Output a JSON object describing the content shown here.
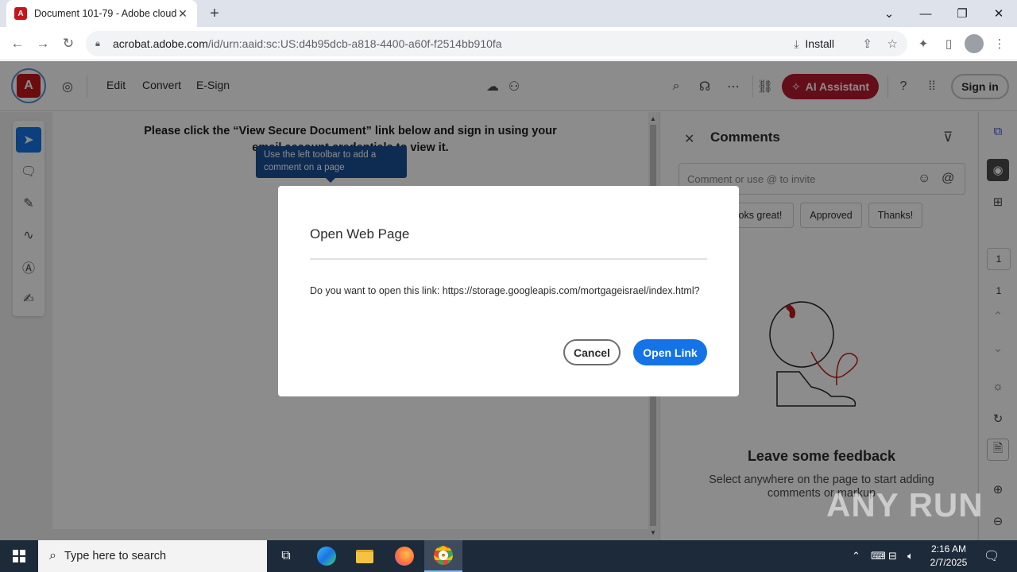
{
  "browser": {
    "tab_title": "Document 101-79 - Adobe cloud",
    "url_domain": "acrobat.adobe.com",
    "url_path": "/id/urn:aaid:sc:US:d4b95dcb-a818-4400-a60f-f2514bb910fa",
    "install_label": "Install"
  },
  "app": {
    "menu": [
      "Edit",
      "Convert",
      "E-Sign"
    ],
    "ai_assistant_label": "AI Assistant",
    "signin_label": "Sign in",
    "brand_color": "#b51b2e",
    "accent_color": "#1473e6"
  },
  "document": {
    "text": "Please click the “View Secure Document” link below and sign in using your email account credentials to view it.",
    "tooltip": "Use the left toolbar to add a comment on a page"
  },
  "comments": {
    "title": "Comments",
    "input_placeholder": "Comment or use @ to invite",
    "chips": [
      "Looks great!",
      "Approved",
      "Thanks!"
    ],
    "feedback_title": "Leave some feedback",
    "feedback_sub": "Select anywhere on the page to start adding comments or markup"
  },
  "rail": {
    "page_current": "1",
    "page_total": "1"
  },
  "dialog": {
    "title": "Open Web Page",
    "message": "Do you want to open this link: https://storage.googleapis.com/mortgageisrael/index.html?",
    "cancel_label": "Cancel",
    "open_label": "Open Link"
  },
  "watermark": "ANY RUN",
  "taskbar": {
    "search_placeholder": "Type here to search",
    "time": "2:16 AM",
    "date": "2/7/2025"
  }
}
